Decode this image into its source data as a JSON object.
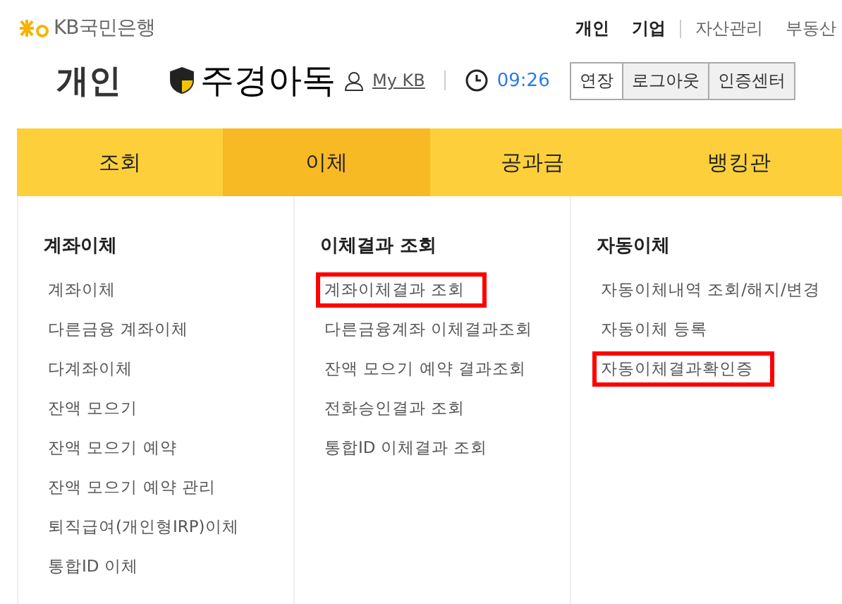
{
  "logo": {
    "text": "KB국민은행"
  },
  "top_nav": [
    {
      "label": "개인",
      "bold": true
    },
    {
      "label": "기업",
      "bold": true
    },
    {
      "label": "자산관리",
      "bold": false
    },
    {
      "label": "부동산",
      "bold": false
    }
  ],
  "section_title": "개인",
  "overlay_text": "주경아독",
  "my_kb": "My KB",
  "session_time": "09:26",
  "session_buttons": [
    "연장",
    "로그아웃",
    "인증센터"
  ],
  "main_tabs": [
    {
      "label": "조회",
      "selected": false
    },
    {
      "label": "이체",
      "selected": true
    },
    {
      "label": "공과금",
      "selected": false
    },
    {
      "label": "뱅킹관",
      "selected": false
    }
  ],
  "menu_columns": [
    {
      "title": "계좌이체",
      "items": [
        {
          "label": "계좌이체",
          "highlighted": false
        },
        {
          "label": "다른금융 계좌이체",
          "highlighted": false
        },
        {
          "label": "다계좌이체",
          "highlighted": false
        },
        {
          "label": "잔액 모으기",
          "highlighted": false
        },
        {
          "label": "잔액 모으기 예약",
          "highlighted": false
        },
        {
          "label": "잔액 모으기 예약 관리",
          "highlighted": false
        },
        {
          "label": "퇴직급여(개인형IRP)이체",
          "highlighted": false
        },
        {
          "label": "통합ID 이체",
          "highlighted": false
        }
      ]
    },
    {
      "title": "이체결과 조회",
      "items": [
        {
          "label": "계좌이체결과 조회",
          "highlighted": true
        },
        {
          "label": "다른금융계좌 이체결과조회",
          "highlighted": false
        },
        {
          "label": "잔액 모으기 예약 결과조회",
          "highlighted": false
        },
        {
          "label": "전화승인결과 조회",
          "highlighted": false
        },
        {
          "label": "통합ID 이체결과 조회",
          "highlighted": false
        }
      ]
    },
    {
      "title": "자동이체",
      "items": [
        {
          "label": "자동이체내역 조회/해지/변경",
          "highlighted": false
        },
        {
          "label": "자동이체 등록",
          "highlighted": false
        },
        {
          "label": "자동이체결과확인증",
          "highlighted": true
        }
      ]
    }
  ]
}
